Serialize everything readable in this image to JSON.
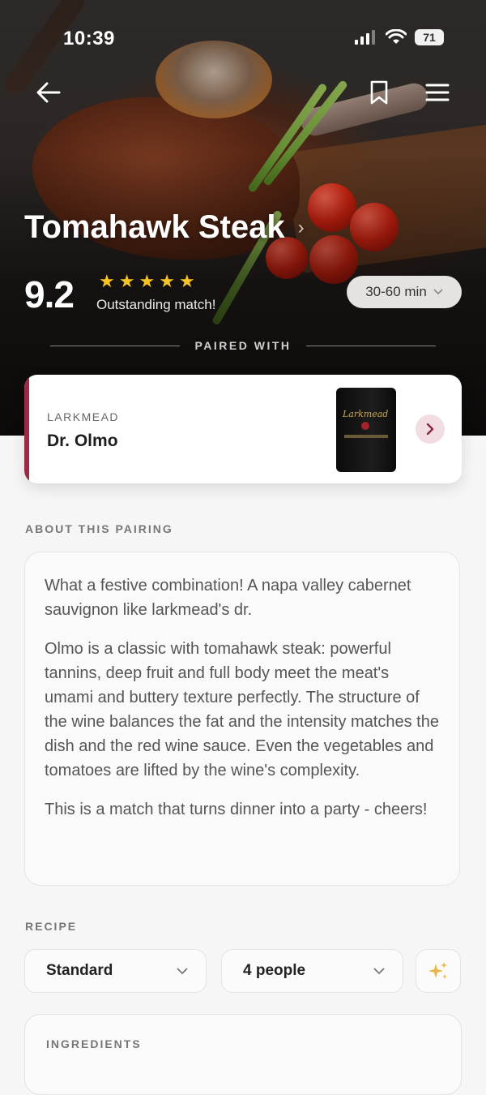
{
  "status": {
    "time": "10:39",
    "battery": "71"
  },
  "header": {
    "back_icon": "arrow-left-icon",
    "bookmark_icon": "bookmark-icon",
    "menu_icon": "hamburger-menu-icon"
  },
  "dish": {
    "title": "Tomahawk Steak",
    "score": "9.2",
    "stars": 5,
    "match_text": "Outstanding match!",
    "time_label": "30-60 min"
  },
  "pairing": {
    "label": "PAIRED WITH",
    "producer": "LARKMEAD",
    "wine": "Dr. Olmo",
    "bottle_label": "Larkmead",
    "accent_color": "#9c2a44"
  },
  "about": {
    "heading": "ABOUT THIS PAIRING",
    "paragraphs": [
      "What a festive combination! A napa valley cabernet sauvignon like larkmead's dr.",
      "Olmo is a classic with tomahawk steak: powerful tannins, deep fruit and full body meet the meat's umami and buttery texture perfectly. The structure of the wine balances the fat and the intensity matches the dish and the red wine sauce. Even the vegetables and tomatoes are lifted by the wine's complexity.",
      "This is a match that turns dinner into a party - cheers!"
    ]
  },
  "recipe": {
    "heading": "RECIPE",
    "style_select": "Standard",
    "servings_select": "4 people",
    "ingredients_heading": "INGREDIENTS"
  }
}
